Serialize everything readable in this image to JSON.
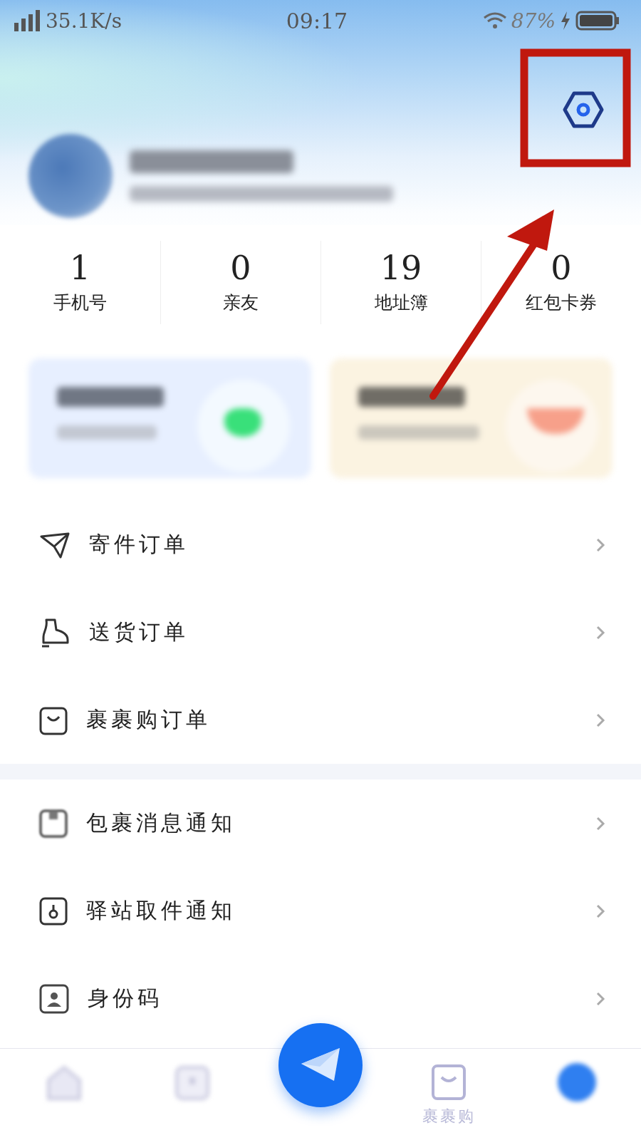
{
  "status_bar": {
    "network_speed": "35.1K/s",
    "time": "09:17",
    "battery": "87%"
  },
  "stats": [
    {
      "value": "1",
      "label": "手机号"
    },
    {
      "value": "0",
      "label": "亲友"
    },
    {
      "value": "19",
      "label": "地址簿"
    },
    {
      "value": "0",
      "label": "红包卡券"
    }
  ],
  "menu_groups": [
    {
      "items": [
        {
          "label": "寄件订单",
          "kind": "send"
        },
        {
          "label": "送货订单",
          "kind": "delivery"
        },
        {
          "label": "裹裹购订单",
          "kind": "bag"
        }
      ]
    },
    {
      "items": [
        {
          "label": "包裹消息通知",
          "kind": "parcel"
        },
        {
          "label": "驿站取件通知",
          "kind": "station"
        },
        {
          "label": "身份码",
          "kind": "id"
        }
      ]
    }
  ],
  "tab_bar": [
    {
      "kind": "home"
    },
    {
      "kind": "box"
    },
    {
      "kind": "send"
    },
    {
      "kind": "bag",
      "label": "裹裹购"
    },
    {
      "kind": "avatar"
    }
  ]
}
